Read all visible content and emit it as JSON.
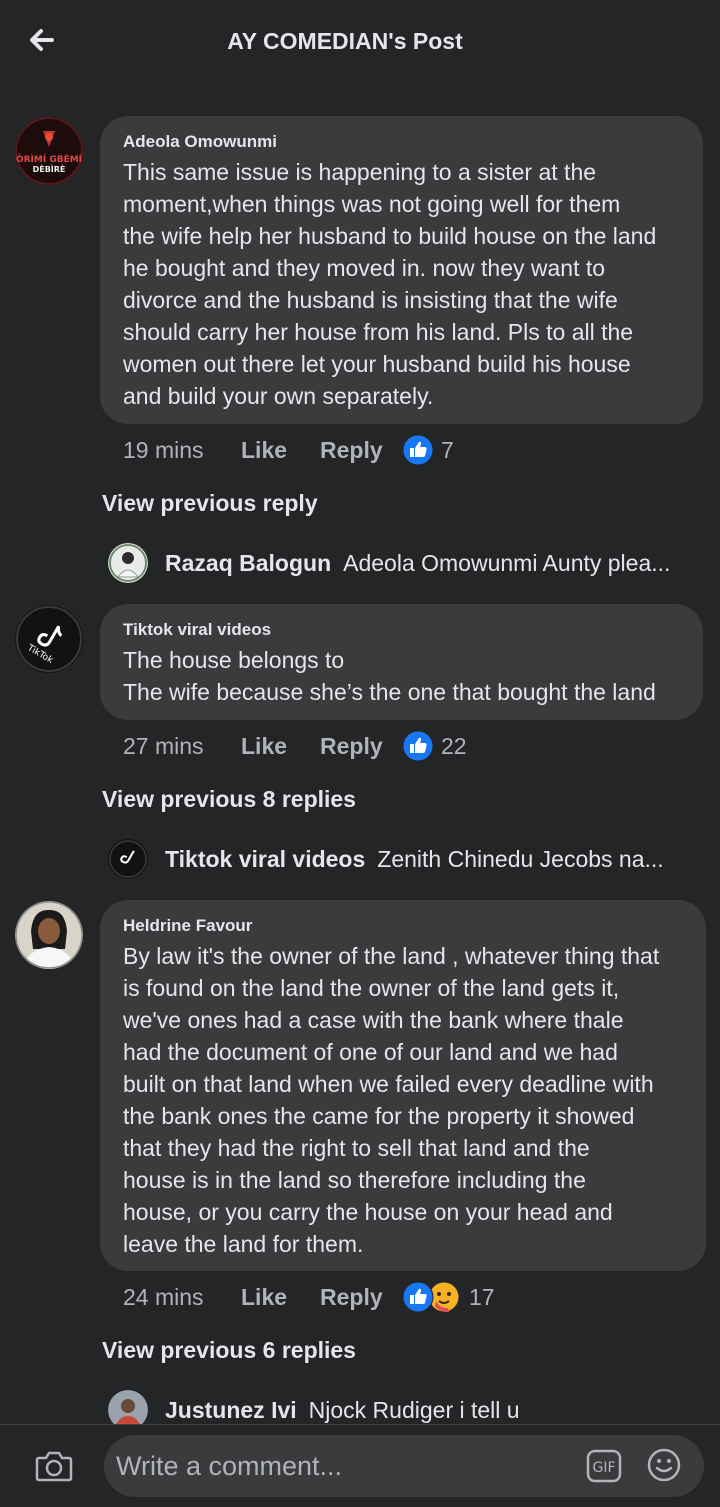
{
  "header": {
    "title": "AY COMEDIAN's Post",
    "back_icon": "back-arrow-icon"
  },
  "comments": [
    {
      "author": "Adeola Omowunmi",
      "avatar_text": [
        "ÒRÌMÍ GBÉMÍ",
        "DÈBÌRÈ"
      ],
      "lines": [
        "This same issue is happening to a sister at the",
        "moment,when things was not going well for them",
        "the wife help her husband to build house on the land",
        "he bought and they moved in.  now they want to",
        "divorce and the husband is insisting that the wife",
        "should carry her house from his land. Pls to all the",
        "women out there let your husband build his house",
        "and build your own separately."
      ],
      "time": "19 mins",
      "like_label": "Like",
      "reply_label": "Reply",
      "reaction_count": "7",
      "view_previous": "View previous reply",
      "reply_preview": {
        "name": "Razaq Balogun",
        "text": "Adeola Omowunmi Aunty plea..."
      }
    },
    {
      "author": "Tiktok viral videos",
      "avatar_text": [
        "TikTok"
      ],
      "lines": [
        "The house belongs to",
        "The wife because she’s the one that bought the land"
      ],
      "time": "27 mins",
      "like_label": "Like",
      "reply_label": "Reply",
      "reaction_count": "22",
      "view_previous": "View previous 8 replies",
      "reply_preview": {
        "name": "Tiktok viral videos",
        "text": "Zenith Chinedu Jecobs na..."
      }
    },
    {
      "author": "Heldrine Favour",
      "lines": [
        "By law it's the owner of the land , whatever thing that",
        "is found on the land the owner of the land gets it,",
        "we've ones had a case with the bank where thale",
        "had the document of one of our land and we had",
        "built on that land when we failed every deadline with",
        "the bank ones the came for the property it showed",
        "that they had the right to sell that land and the",
        "house is in the land so therefore including the",
        "house, or you carry the house on your head and",
        "leave the land for them."
      ],
      "time": "24 mins",
      "like_label": "Like",
      "reply_label": "Reply",
      "reaction_count": "17",
      "view_previous": "View previous 6 replies",
      "reply_preview": {
        "name": "Justunez Ivi",
        "text": "Njock Rudiger i tell u"
      }
    }
  ],
  "composer": {
    "placeholder": "Write a comment...",
    "gif_label": "GIF"
  },
  "colors": {
    "background": "#242526",
    "bubble": "#3a3b3c",
    "like_blue": "#1877f2",
    "text": "#e4e6eb",
    "muted": "#b0b3b8"
  }
}
